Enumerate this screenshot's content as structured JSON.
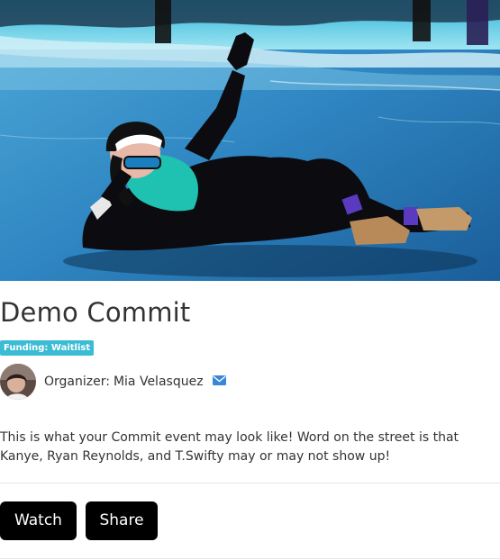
{
  "event": {
    "title": "Demo Commit",
    "funding_badge": "Funding: Waitlist",
    "hero_image": "person-lying-on-frozen-lake-photo"
  },
  "organizer": {
    "label": "Organizer:",
    "name": "Mia Velasquez",
    "contact_icon": "envelope-icon"
  },
  "description": "This is what your Commit event may look like! Word on the street is that Kanye, Ryan Reynolds, and T.Swifty may or may not show up!",
  "actions": {
    "watch_label": "Watch",
    "share_label": "Share"
  },
  "colors": {
    "badge": "#3bbcd4",
    "button": "#000000",
    "mail_icon": "#3a87d6",
    "text": "#333333"
  }
}
